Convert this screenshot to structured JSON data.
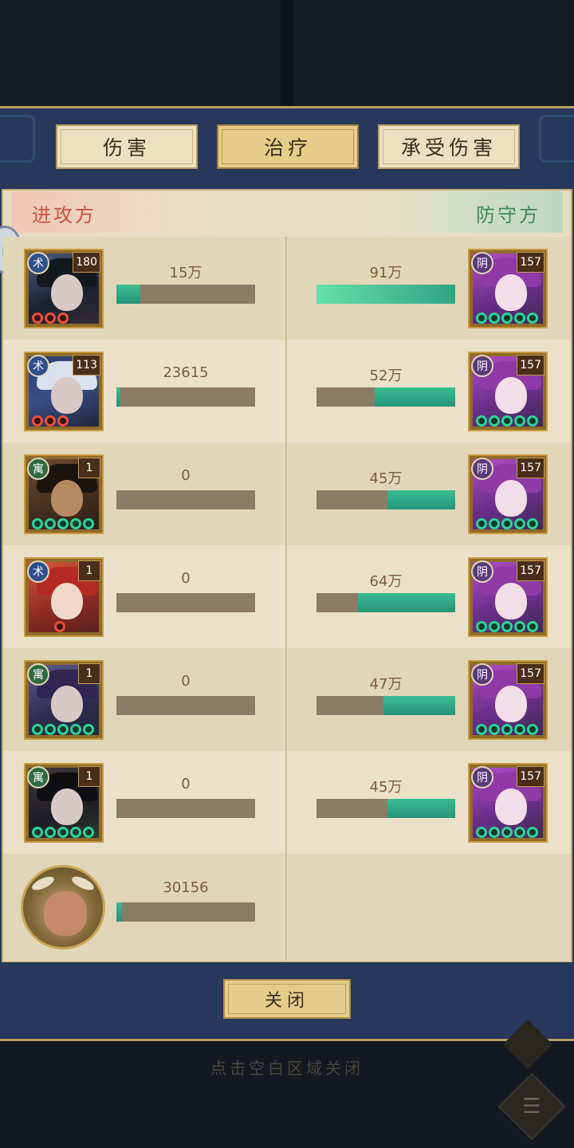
{
  "tabs": [
    {
      "label": "伤害",
      "active": false
    },
    {
      "label": "治疗",
      "active": true
    },
    {
      "label": "承受伤害",
      "active": false
    }
  ],
  "sides": {
    "attacker": "进攻方",
    "defender": "防守方"
  },
  "rows": [
    {
      "attacker": {
        "faction": "术",
        "level": "180",
        "jade": "red3",
        "value": "15万",
        "fill": 0.17
      },
      "defender": {
        "faction": "阴",
        "level": "157",
        "jade": "green5",
        "value": "91万",
        "fill": 1.0
      }
    },
    {
      "attacker": {
        "faction": "术",
        "level": "113",
        "jade": "red3",
        "value": "23615",
        "fill": 0.03
      },
      "defender": {
        "faction": "阴",
        "level": "157",
        "jade": "green5",
        "value": "52万",
        "fill": 0.58
      }
    },
    {
      "attacker": {
        "faction": "寓",
        "level": "1",
        "jade": "green5",
        "value": "0",
        "fill": 0
      },
      "defender": {
        "faction": "阴",
        "level": "157",
        "jade": "green5",
        "value": "45万",
        "fill": 0.49
      }
    },
    {
      "attacker": {
        "faction": "术",
        "level": "1",
        "jade": "red1",
        "value": "0",
        "fill": 0
      },
      "defender": {
        "faction": "阴",
        "level": "157",
        "jade": "green5",
        "value": "64万",
        "fill": 0.7
      }
    },
    {
      "attacker": {
        "faction": "寓",
        "level": "1",
        "jade": "green5",
        "value": "0",
        "fill": 0
      },
      "defender": {
        "faction": "阴",
        "level": "157",
        "jade": "green5",
        "value": "47万",
        "fill": 0.52
      }
    },
    {
      "attacker": {
        "faction": "寓",
        "level": "1",
        "jade": "green5",
        "value": "0",
        "fill": 0
      },
      "defender": {
        "faction": "阴",
        "level": "157",
        "jade": "green5",
        "value": "45万",
        "fill": 0.49
      }
    }
  ],
  "summon": {
    "value": "30156",
    "fill": 0.04
  },
  "close_label": "关闭",
  "hint": "点击空白区域关闭",
  "colors": {
    "bar_fill": "#2fa583",
    "bar_track": "#8d7c65",
    "attacker_label": "#c8533f",
    "defender_label": "#3f8a57"
  }
}
